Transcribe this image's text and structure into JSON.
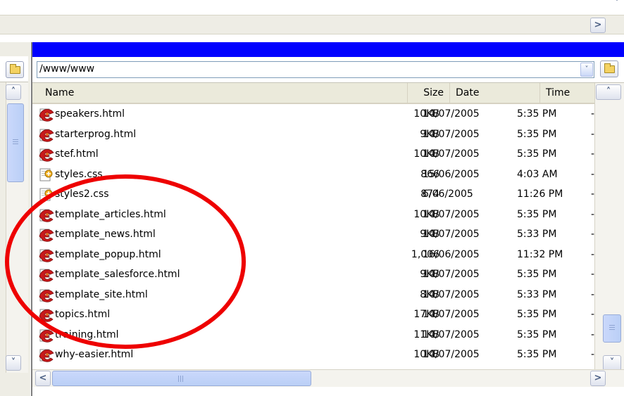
{
  "top": {
    "scroll_up_glyph": "˅",
    "scroll_right_glyph": ">"
  },
  "path_bar": {
    "path_value": "/www/www",
    "dropdown_glyph": "˅"
  },
  "columns": {
    "name": "Name",
    "size": "Size",
    "date": "Date",
    "time": "Time"
  },
  "files": [
    {
      "name": "speakers.html",
      "size": "10KB",
      "date": "14/07/2005",
      "time": "5:35 PM",
      "icon": "html-file-icon"
    },
    {
      "name": "starterprog.html",
      "size": "9KB",
      "date": "14/07/2005",
      "time": "5:35 PM",
      "icon": "html-file-icon"
    },
    {
      "name": "stef.html",
      "size": "10KB",
      "date": "14/07/2005",
      "time": "5:35 PM",
      "icon": "html-file-icon"
    },
    {
      "name": "styles.css",
      "size": "866",
      "date": "15/06/2005",
      "time": "4:03 AM",
      "icon": "css-file-icon"
    },
    {
      "name": "styles2.css",
      "size": "874",
      "date": "6/06/2005",
      "time": "11:26 PM",
      "icon": "css-file-icon"
    },
    {
      "name": "template_articles.html",
      "size": "10KB",
      "date": "14/07/2005",
      "time": "5:35 PM",
      "icon": "html-file-icon"
    },
    {
      "name": "template_news.html",
      "size": "9KB",
      "date": "14/07/2005",
      "time": "5:33 PM",
      "icon": "html-file-icon"
    },
    {
      "name": "template_popup.html",
      "size": "1,006",
      "date": "16/06/2005",
      "time": "11:32 PM",
      "icon": "html-file-icon"
    },
    {
      "name": "template_salesforce.html",
      "size": "9KB",
      "date": "14/07/2005",
      "time": "5:35 PM",
      "icon": "html-file-icon"
    },
    {
      "name": "template_site.html",
      "size": "8KB",
      "date": "14/07/2005",
      "time": "5:33 PM",
      "icon": "html-file-icon"
    },
    {
      "name": "topics.html",
      "size": "17KB",
      "date": "14/07/2005",
      "time": "5:35 PM",
      "icon": "html-file-icon"
    },
    {
      "name": "training.html",
      "size": "11KB",
      "date": "14/07/2005",
      "time": "5:35 PM",
      "icon": "html-file-icon"
    },
    {
      "name": "why-easier.html",
      "size": "10KB",
      "date": "14/07/2005",
      "time": "5:35 PM",
      "icon": "html-file-icon"
    }
  ],
  "row_dash": "-",
  "scroll": {
    "up_glyph": "˄",
    "down_glyph": "˅",
    "left_glyph": "<",
    "right_glyph": ">"
  },
  "colors": {
    "title_bar": "#0000ff",
    "annotation_circle": "#ee0000",
    "chrome": "#eeede5"
  }
}
